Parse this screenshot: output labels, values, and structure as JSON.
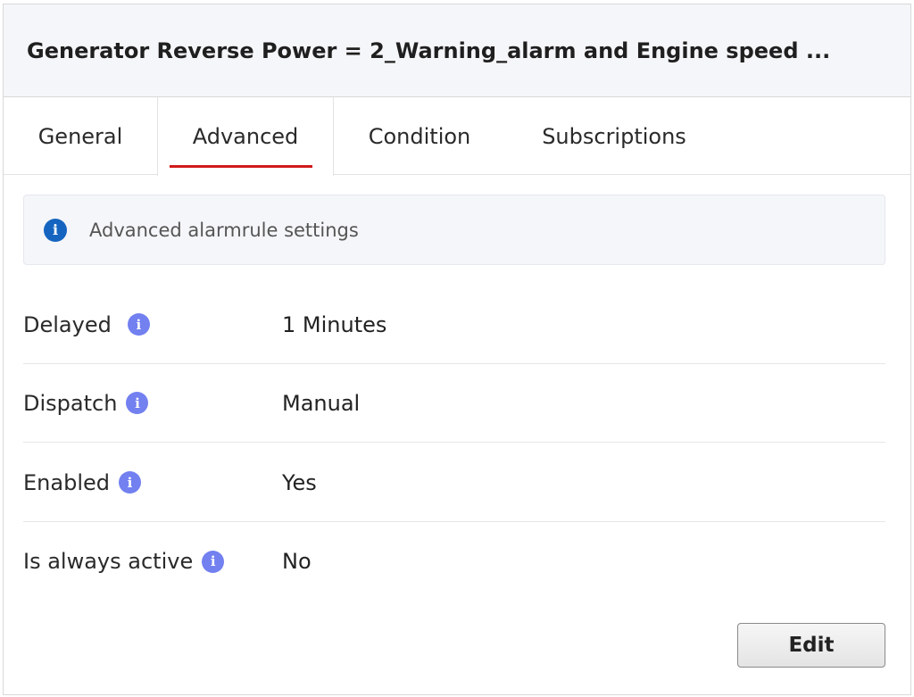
{
  "header": {
    "title": "Generator Reverse Power = 2_Warning_alarm and Engine speed ..."
  },
  "tabs": [
    {
      "label": "General",
      "active": false
    },
    {
      "label": "Advanced",
      "active": true
    },
    {
      "label": "Condition",
      "active": false
    },
    {
      "label": "Subscriptions",
      "active": false
    }
  ],
  "info": {
    "icon": "info-icon",
    "text": "Advanced alarmrule settings"
  },
  "settings": [
    {
      "label": "Delayed",
      "value": "1 Minutes"
    },
    {
      "label": "Dispatch",
      "value": "Manual"
    },
    {
      "label": "Enabled",
      "value": "Yes"
    },
    {
      "label": "Is always active",
      "value": "No"
    }
  ],
  "actions": {
    "edit_label": "Edit"
  },
  "colors": {
    "active_tab_underline": "#d11a1a",
    "info_icon": "#1565c0",
    "hint_icon": "#7280f0"
  }
}
